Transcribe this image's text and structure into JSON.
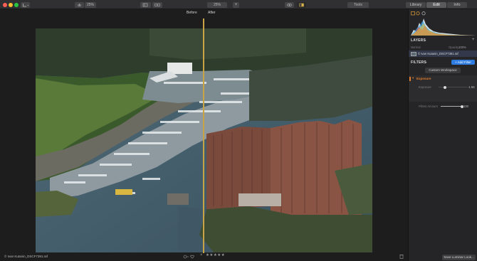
{
  "toolbar": {
    "zoom_value": "25%",
    "zoom_value_2": "25%",
    "add_label": "+",
    "tools_label": "Tools",
    "tabs": [
      {
        "label": "Library",
        "active": false
      },
      {
        "label": "Edit",
        "active": true
      },
      {
        "label": "Info",
        "active": false
      }
    ]
  },
  "canvas": {
    "before_label": "Before",
    "after_label": "After"
  },
  "status": {
    "filename": "© Ivan Kutanin_DSCF7391.raf",
    "close_mark": "×",
    "stars": "★★★★★"
  },
  "panel": {
    "layers": {
      "title": "LAYERS",
      "blend_mode": "Normal",
      "opacity_label": "Opacity",
      "opacity_value": "100%",
      "layer_name": "© Ivan Kutanin_DSCF7391.raf"
    },
    "filters": {
      "title": "FILTERS",
      "add_filter_label": "+ Add Filter",
      "workspace_label": "Custom Workspace",
      "exposure_title": "Exposure",
      "exposure_label": "Exposure",
      "exposure_value": "-1.55",
      "exposure_level": 0.22,
      "amount_label": "Filters Amount",
      "amount_value": "100",
      "amount_level": 1.0
    },
    "save_look_label": "Save Luminar Look..."
  }
}
